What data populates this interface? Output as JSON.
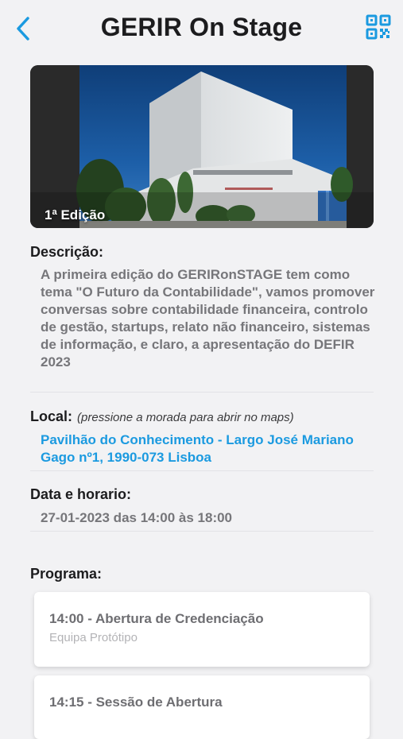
{
  "header": {
    "title": "GERIR On Stage",
    "back_icon": "chevron-left-icon",
    "qr_icon": "qr-code-icon",
    "accent_color": "#1b9ae0"
  },
  "hero": {
    "edition_label": "1ª Edição"
  },
  "description": {
    "label": "Descrição:",
    "text": "A primeira edição do GERIRonSTAGE tem como tema \"O Futuro da Contabilidade\", vamos promover conversas sobre contabilidade financeira, controlo de gestão, startups, relato não financeiro, sistemas de informação, e claro, a apresentação do DEFIR 2023"
  },
  "location": {
    "label": "Local:",
    "hint": "(pressione a morada para abrir no maps)",
    "address": "Pavilhão do Conhecimento - Largo José Mariano Gago nº1, 1990-073 Lisboa"
  },
  "schedule": {
    "label": "Data e horario:",
    "value": "27-01-2023 das 14:00 às 18:00"
  },
  "program": {
    "label": "Programa:",
    "items": [
      {
        "time_title": "14:00 - Abertura de Credenciação",
        "subtitle": "Equipa Protótipo"
      },
      {
        "time_title": "14:15 - Sessão de Abertura",
        "subtitle": ""
      }
    ]
  }
}
